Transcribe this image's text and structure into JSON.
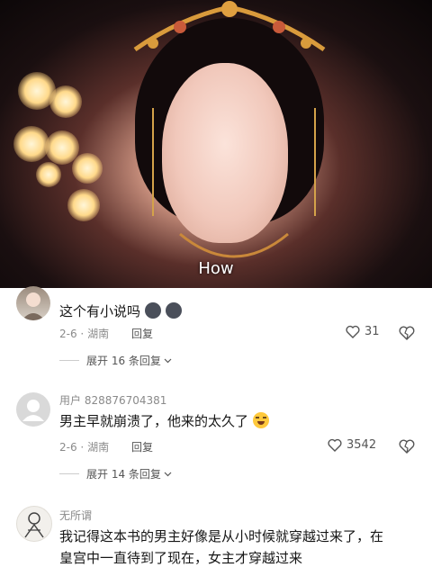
{
  "video": {
    "subtitle": "How"
  },
  "comments": [
    {
      "username": "",
      "text": "这个有小说吗",
      "date": "2-6",
      "location": "湖南",
      "reply_label": "回复",
      "likes": "31",
      "expand_label": "展开 16 条回复"
    },
    {
      "username": "用户 828876704381",
      "text": "男主早就崩溃了，他来的太久了",
      "date": "2-6",
      "location": "湖南",
      "reply_label": "回复",
      "likes": "3542",
      "expand_label": "展开 14 条回复"
    },
    {
      "username": "无所谓",
      "text_line1": "我记得这本书的男主好像是从小时候就穿越过来了，在",
      "text_line2": "皇宫中一直待到了现在，女主才穿越过来"
    }
  ],
  "colors": {
    "muted_text": "#8a8a8a",
    "body_text": "#161616"
  }
}
